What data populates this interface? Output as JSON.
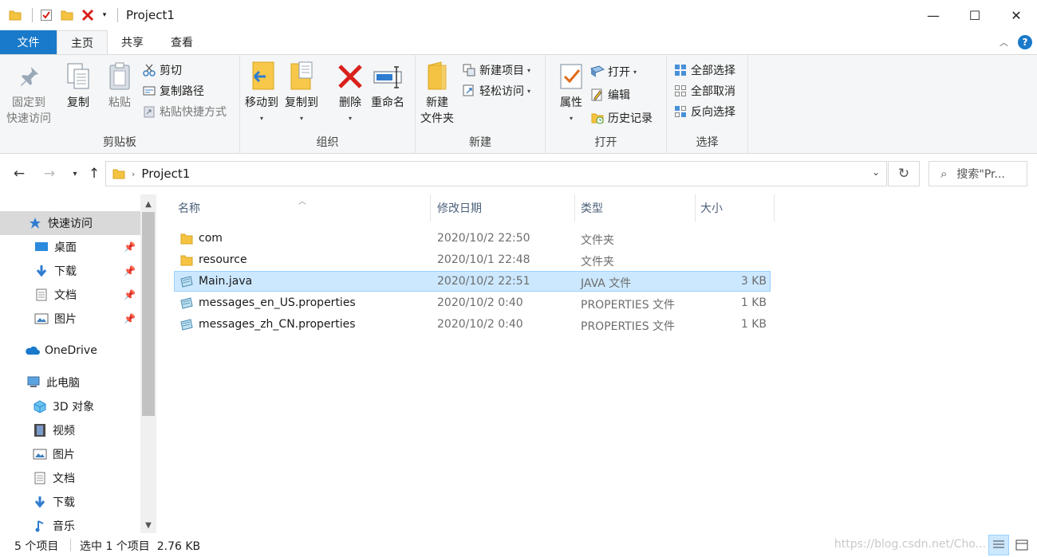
{
  "window": {
    "title": "Project1",
    "minimize_glyph": "—",
    "maximize_glyph": "☐",
    "close_glyph": "✕"
  },
  "quick_access_toolbar": {
    "icons": [
      "folder-icon",
      "properties-check-icon",
      "new-folder-icon",
      "delete-x-icon",
      "customize-dropdown-icon"
    ]
  },
  "ribbon_tabs": [
    {
      "label": "文件"
    },
    {
      "label": "主页"
    },
    {
      "label": "共享"
    },
    {
      "label": "查看"
    }
  ],
  "ribbon": {
    "clipboard": {
      "group_label": "剪贴板",
      "pin_label_1": "固定到",
      "pin_label_2": "快速访问",
      "copy_label": "复制",
      "paste_label": "粘贴",
      "cut_label": "剪切",
      "copy_path_label": "复制路径",
      "paste_shortcut_label": "粘贴快捷方式"
    },
    "organize": {
      "group_label": "组织",
      "move_to_label": "移动到",
      "copy_to_label": "复制到",
      "delete_label": "删除",
      "rename_label": "重命名"
    },
    "new": {
      "group_label": "新建",
      "new_folder_label_1": "新建",
      "new_folder_label_2": "文件夹",
      "new_item_label": "新建项目",
      "easy_access_label": "轻松访问"
    },
    "open": {
      "group_label": "打开",
      "properties_label": "属性",
      "open_label": "打开",
      "edit_label": "编辑",
      "history_label": "历史记录"
    },
    "select": {
      "group_label": "选择",
      "select_all_label": "全部选择",
      "select_none_label": "全部取消",
      "invert_label": "反向选择"
    }
  },
  "address_bar": {
    "path": "Project1",
    "search_placeholder": "搜索\"Pr..."
  },
  "nav_pane": {
    "items": [
      {
        "label": "快速访问",
        "icon": "star-icon",
        "selected": true
      },
      {
        "label": "桌面",
        "icon": "desktop-icon",
        "pinned": true
      },
      {
        "label": "下载",
        "icon": "download-icon",
        "pinned": true
      },
      {
        "label": "文档",
        "icon": "document-icon",
        "pinned": true
      },
      {
        "label": "图片",
        "icon": "pictures-icon",
        "pinned": true
      },
      {
        "label": "OneDrive",
        "icon": "onedrive-cloud-icon"
      },
      {
        "label": "此电脑",
        "icon": "this-pc-icon"
      },
      {
        "label": "3D 对象",
        "icon": "3d-objects-icon"
      },
      {
        "label": "视频",
        "icon": "video-icon"
      },
      {
        "label": "图片",
        "icon": "pictures-icon"
      },
      {
        "label": "文档",
        "icon": "document-icon"
      },
      {
        "label": "下载",
        "icon": "download-icon"
      },
      {
        "label": "音乐",
        "icon": "music-icon"
      }
    ]
  },
  "file_list": {
    "columns": [
      "名称",
      "修改日期",
      "类型",
      "大小"
    ],
    "rows": [
      {
        "name": "com",
        "date": "2020/10/2 22:50",
        "type": "文件夹",
        "size": "",
        "icon": "folder-icon"
      },
      {
        "name": "resource",
        "date": "2020/10/1 22:48",
        "type": "文件夹",
        "size": "",
        "icon": "folder-icon"
      },
      {
        "name": "Main.java",
        "date": "2020/10/2 22:51",
        "type": "JAVA 文件",
        "size": "3 KB",
        "icon": "java-file-icon",
        "selected": true
      },
      {
        "name": "messages_en_US.properties",
        "date": "2020/10/2 0:40",
        "type": "PROPERTIES 文件",
        "size": "1 KB",
        "icon": "properties-file-icon"
      },
      {
        "name": "messages_zh_CN.properties",
        "date": "2020/10/2 0:40",
        "type": "PROPERTIES 文件",
        "size": "1 KB",
        "icon": "properties-file-icon"
      }
    ]
  },
  "status_bar": {
    "item_count": "5 个项目",
    "selection": "选中 1 个项目  2.76 KB",
    "watermark": "https://blog.csdn.net/Cho..."
  },
  "colors": {
    "accent": "#1979ca",
    "selection_bg": "#cce8ff",
    "selection_border": "#99d1ff",
    "folder": "#f5c342",
    "delete_red": "#d9201a"
  }
}
